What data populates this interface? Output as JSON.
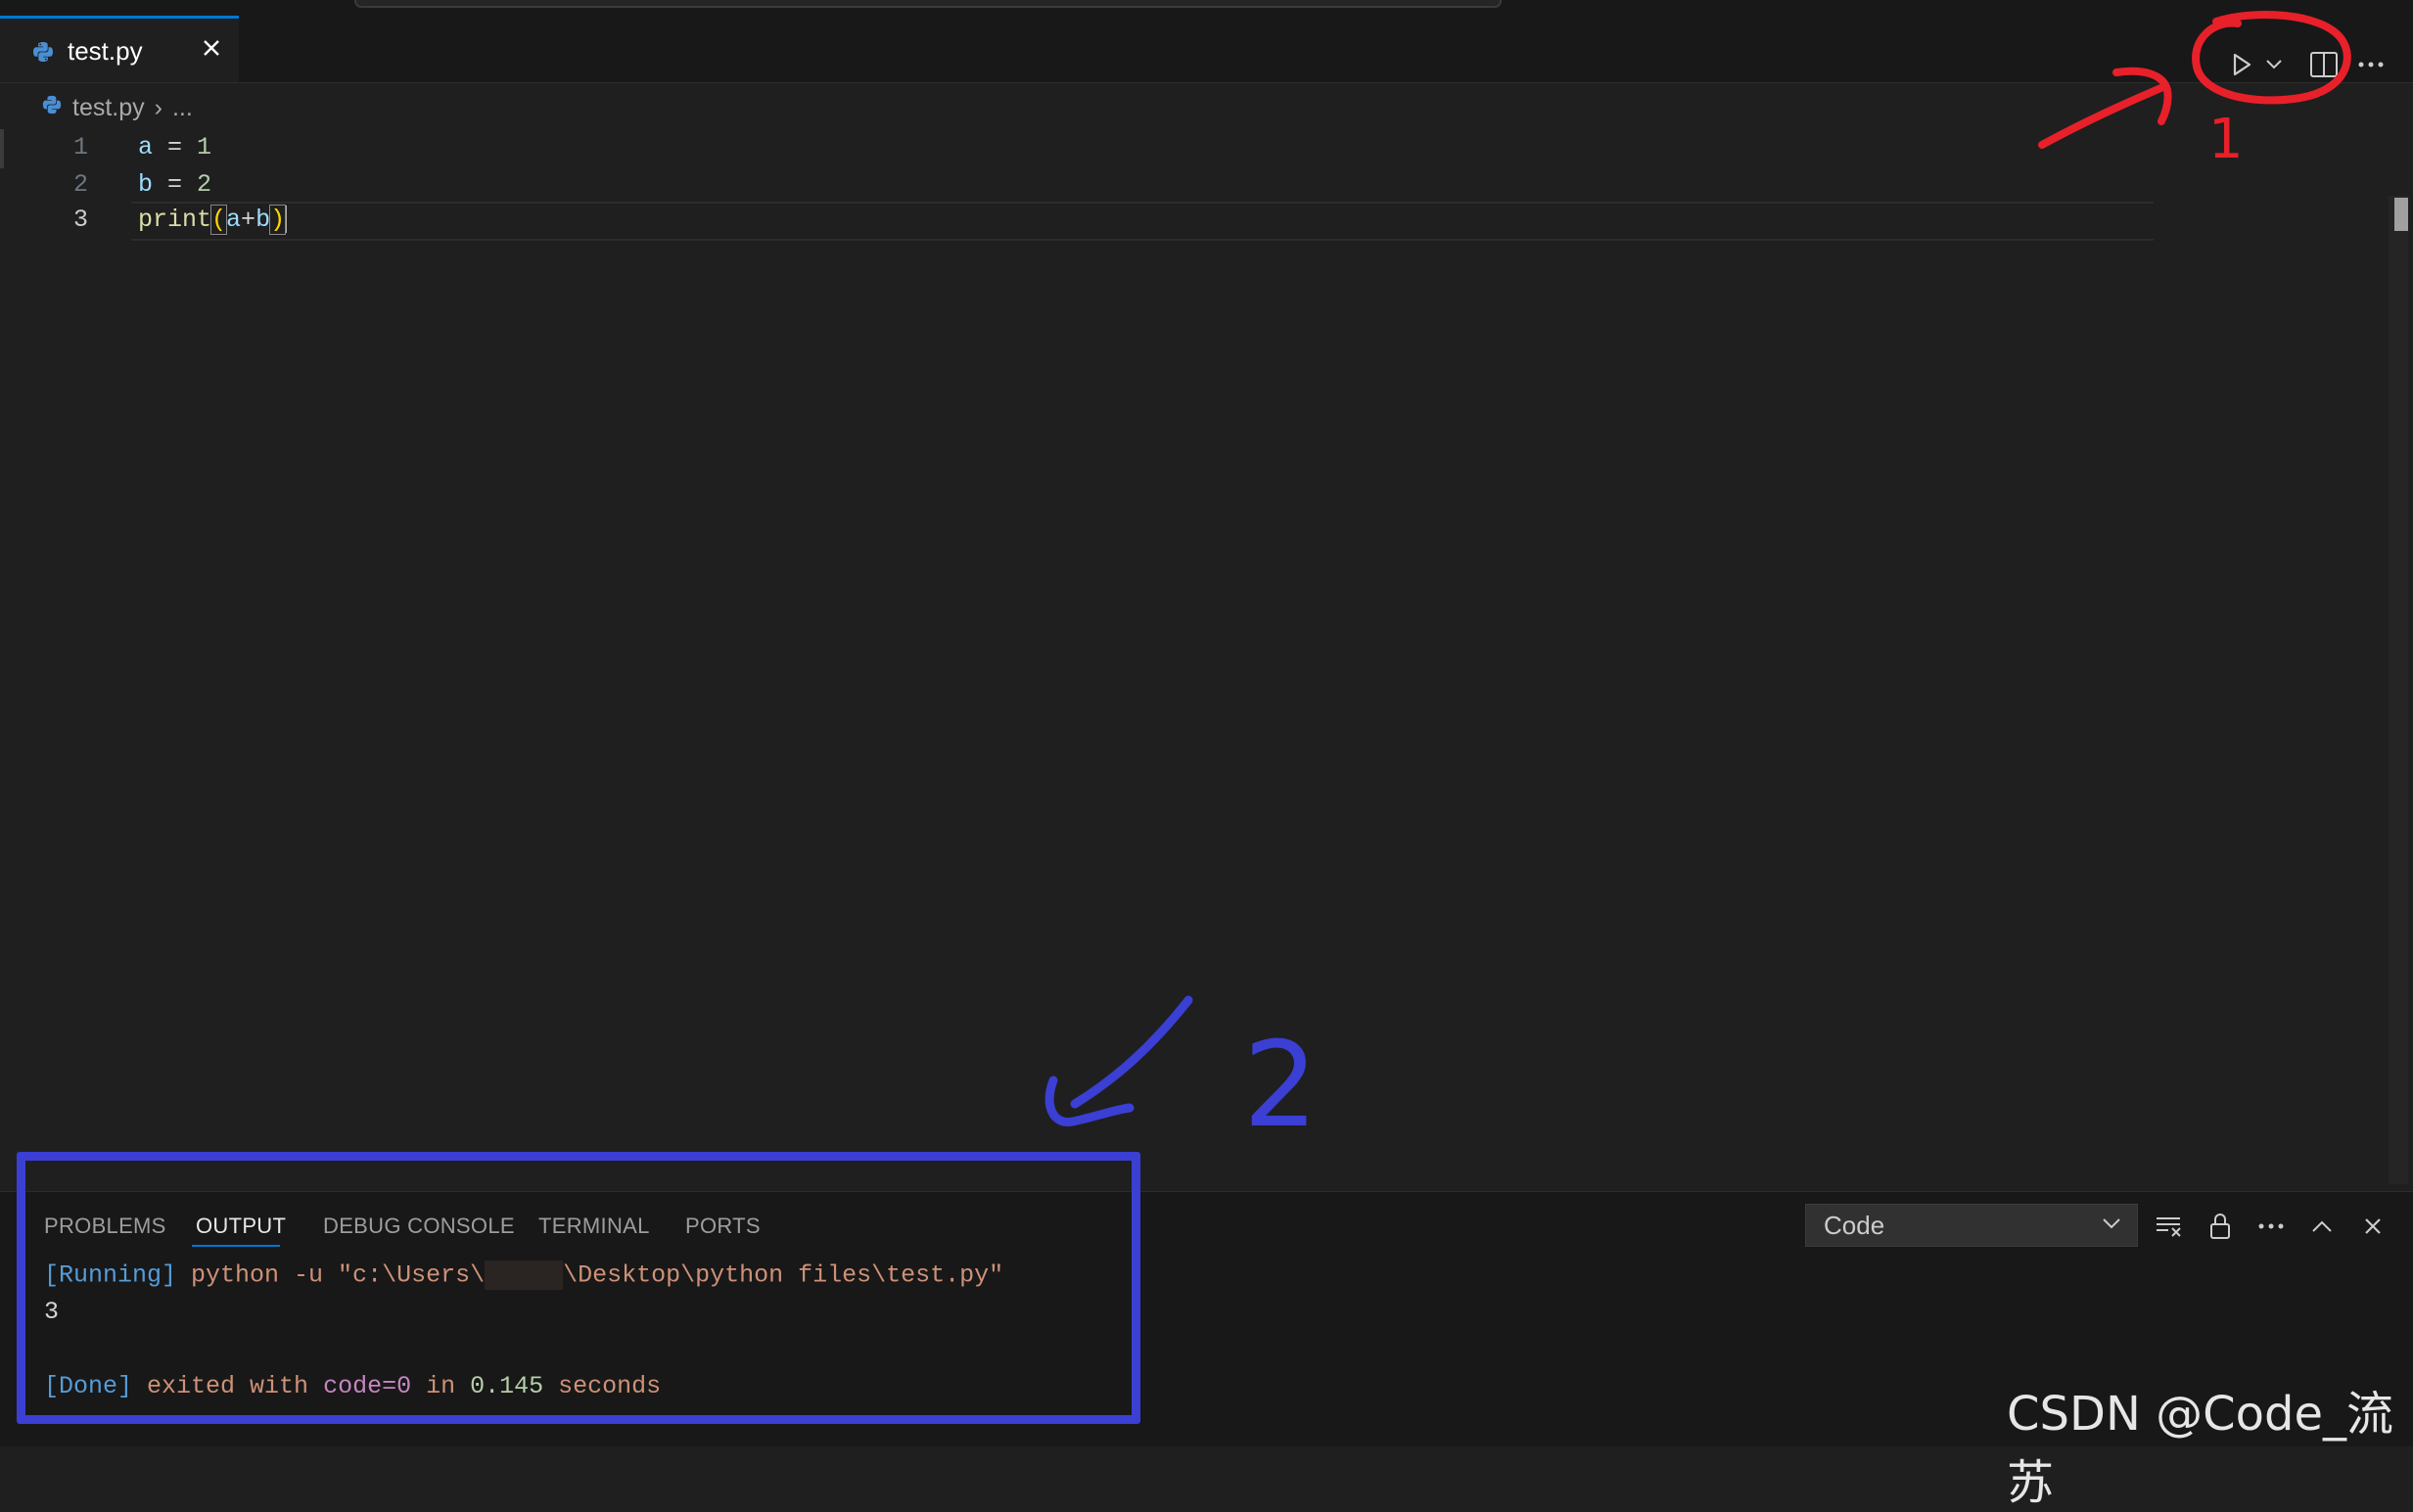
{
  "tab": {
    "name": "test.py",
    "close": "×"
  },
  "breadcrumb": {
    "file": "test.py",
    "sep": "›",
    "rest": "..."
  },
  "editor": {
    "lines": [
      {
        "n": "1",
        "parts": [
          "a",
          " = ",
          "1"
        ]
      },
      {
        "n": "2",
        "parts": [
          "b",
          " = ",
          "2"
        ]
      },
      {
        "n": "3",
        "parts": [
          "print",
          "(",
          "a",
          "+",
          "b",
          ")"
        ]
      }
    ]
  },
  "panel": {
    "tabs": [
      "PROBLEMS",
      "OUTPUT",
      "DEBUG CONSOLE",
      "TERMINAL",
      "PORTS"
    ],
    "active_tab": "OUTPUT",
    "channel": "Code",
    "output": {
      "running_tag": "[Running]",
      "cmd_a": " python -u \"c:\\Users\\",
      "cmd_b": "\\Desktop\\python files\\test.py\"",
      "result": "3",
      "done_tag": "[Done]",
      "exited": " exited with ",
      "code": "code=0",
      "in": " in ",
      "time": "0.145",
      "seconds": " seconds"
    }
  },
  "annotations": {
    "label1": "1",
    "label2": "2"
  },
  "watermark": "CSDN @Code_流苏",
  "colors": {
    "accent": "#0078d4",
    "annot_red": "#e8202a",
    "annot_blue": "#3b3fd4"
  }
}
